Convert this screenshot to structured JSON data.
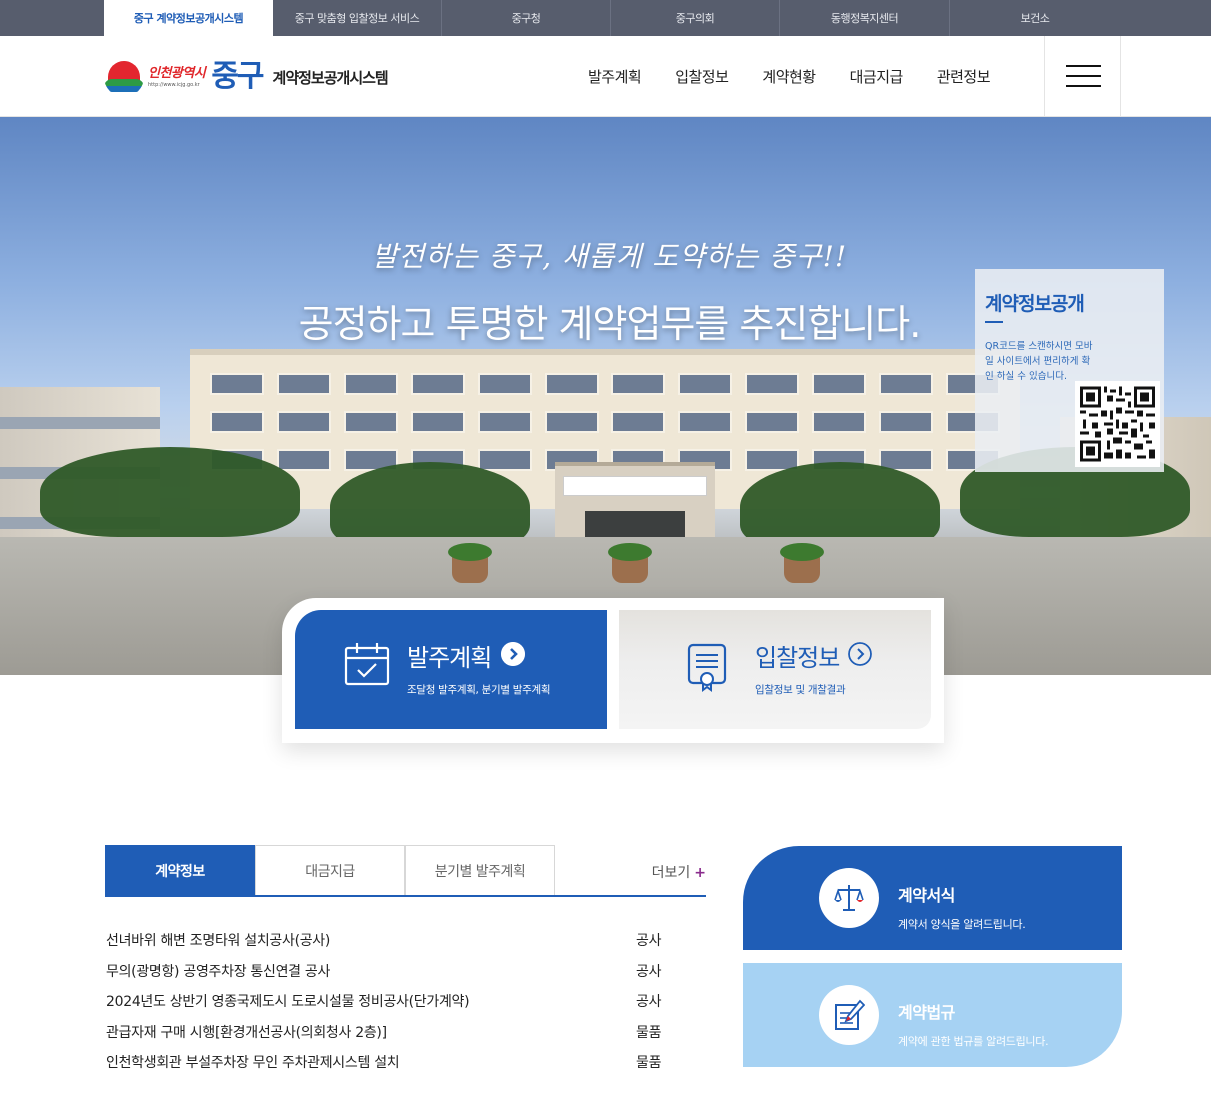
{
  "topbar": {
    "tabs": [
      {
        "label": "중구 계약정보공개시스템",
        "active": true
      },
      {
        "label": "중구 맞춤형 입찰정보 서비스",
        "active": false
      },
      {
        "label": "중구청",
        "active": false
      },
      {
        "label": "중구의회",
        "active": false
      },
      {
        "label": "동행정복지센터",
        "active": false
      },
      {
        "label": "보건소",
        "active": false
      }
    ]
  },
  "header": {
    "logo": {
      "city": "인천광역시",
      "url": "http://www.icjg.go.kr",
      "gu": "중구",
      "system": "계약정보공개시스템"
    },
    "nav": [
      "발주계획",
      "입찰정보",
      "계약현황",
      "대금지급",
      "관련정보"
    ],
    "menu_icon": "hamburger-icon"
  },
  "hero": {
    "slogan_1": "발전하는 중구, 새롭게 도약하는 중구!!",
    "slogan_2": "공정하고 투명한 계약업무를 추진합니다.",
    "qr": {
      "title": "계약정보공개",
      "desc": "QR코드를 스캔하시면 모바일 사이트에서 편리하게 확인 하실 수 있습니다."
    }
  },
  "quick": {
    "order": {
      "label": "발주계획",
      "sub": "조달청 발주계획, 분기별 발주계획",
      "icon": "calendar-check-icon"
    },
    "bid": {
      "label": "입찰정보",
      "sub": "입찰정보 및 개찰결과",
      "icon": "document-certificate-icon"
    }
  },
  "contract": {
    "tabs": [
      "계약정보",
      "대금지급",
      "분기별 발주계획"
    ],
    "active_tab": "계약정보",
    "more": "더보기",
    "more_symbol": "+",
    "rows": [
      {
        "title": "선녀바위 해변 조명타워 설치공사(공사)",
        "category": "공사"
      },
      {
        "title": "무의(광명항) 공영주차장 통신연결 공사",
        "category": "공사"
      },
      {
        "title": "2024년도 상반기 영종국제도시 도로시설물 정비공사(단가계약)",
        "category": "공사"
      },
      {
        "title": "관급자재 구매 시행[환경개선공사(의회청사 2층)]",
        "category": "물품"
      },
      {
        "title": "인천학생회관 부설주차장 무인 주차관제시스템 설치",
        "category": "물품"
      }
    ]
  },
  "side": {
    "forms": {
      "title": "계약서식",
      "desc": "계약서 양식을 알려드립니다.",
      "icon": "scale-icon"
    },
    "laws": {
      "title": "계약법규",
      "desc": "계약에 관한 법규를 알려드립니다.",
      "icon": "pen-document-icon"
    }
  },
  "colors": {
    "brand": "#1f5db6",
    "topbar": "#575d6d",
    "light_panel": "#a6d2f3"
  }
}
